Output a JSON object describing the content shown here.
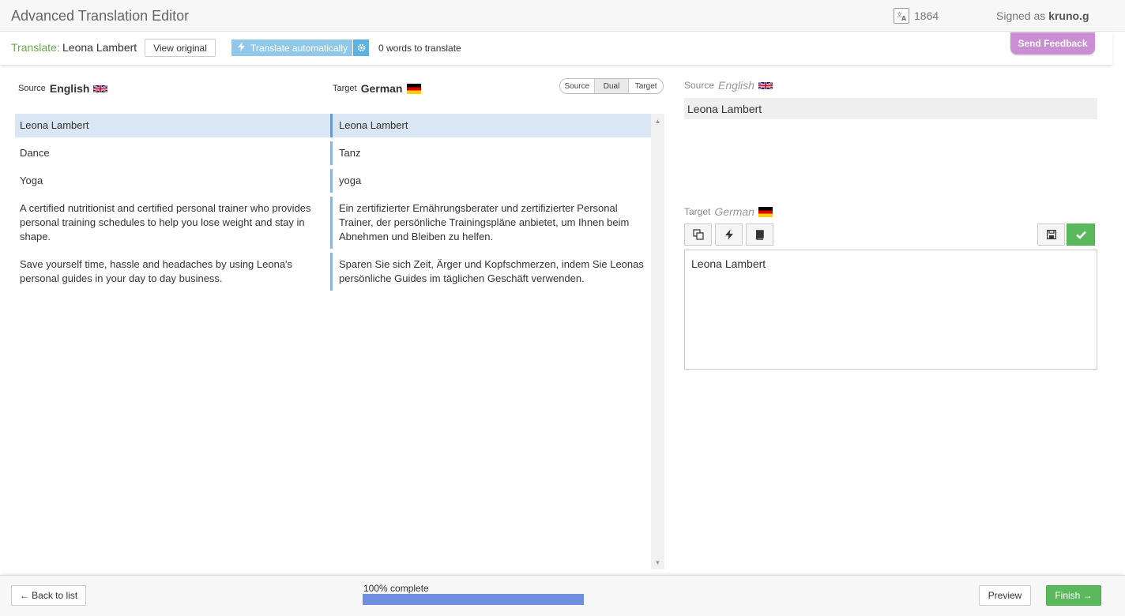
{
  "app": {
    "title": "Advanced Translation Editor"
  },
  "header": {
    "credits": "1864",
    "signed_prefix": "Signed as",
    "username": "kruno.g"
  },
  "toolbar": {
    "translate_label": "Translate:",
    "document_name": "Leona Lambert",
    "view_original": "View original",
    "translate_auto": "Translate automatically",
    "words_status": "0 words to translate",
    "send_feedback": "Send Feedback"
  },
  "left": {
    "source_prefix": "Source",
    "source_lang": "English",
    "target_prefix": "Target",
    "target_lang": "German",
    "view_modes": [
      "Source",
      "Dual",
      "Target"
    ],
    "active_view": "Dual",
    "segments": [
      {
        "source": "Leona Lambert",
        "target": "Leona Lambert",
        "active": true
      },
      {
        "source": "Dance",
        "target": "Tanz"
      },
      {
        "source": "Yoga",
        "target": "yoga"
      },
      {
        "source": "A certified nutritionist and certified personal trainer who provides personal training schedules to help you lose weight and stay in shape.",
        "target": "Ein zertifizierter Ernährungsberater und zertifizierter Personal Trainer, der persönliche Trainingspläne anbietet, um Ihnen beim Abnehmen und Bleiben zu helfen."
      },
      {
        "source": "Save yourself time, hassle and headaches by using Leona's personal guides in your day to day business.",
        "target": "Sparen Sie sich Zeit, Ärger und Kopfschmerzen, indem Sie Leonas persönliche Guides im täglichen Geschäft verwenden."
      }
    ]
  },
  "right": {
    "source_prefix": "Source",
    "source_lang": "English",
    "source_text": "Leona Lambert",
    "target_prefix": "Target",
    "target_lang": "German",
    "target_text": "Leona Lambert"
  },
  "footer": {
    "back": "← Back to list",
    "progress_label": "100% complete",
    "progress": 1.0,
    "preview": "Preview",
    "finish": "Finish →"
  },
  "colors": {
    "accent_green": "#5cb85c",
    "feedback": "#c98fd2",
    "active_row": "#dae6f3",
    "progress": "#6f8fde"
  }
}
